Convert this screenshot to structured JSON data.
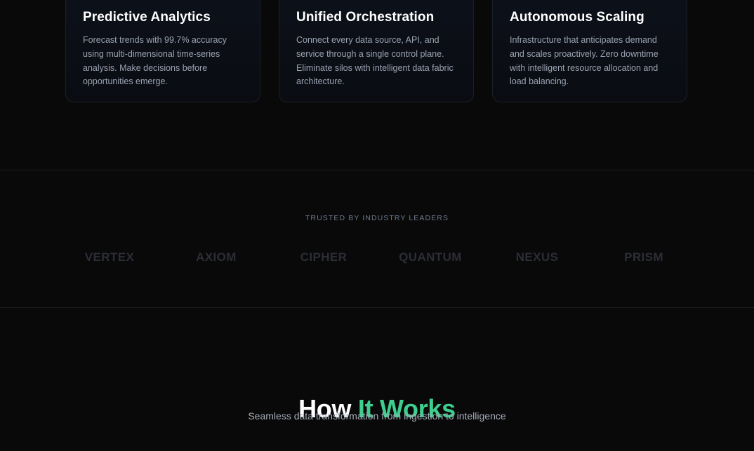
{
  "features": {
    "cards": [
      {
        "title": "Predictive Analytics",
        "description": "Forecast trends with 99.7% accuracy using multi-dimensional time-series analysis. Make decisions before opportunities emerge."
      },
      {
        "title": "Unified Orchestration",
        "description": "Connect every data source, API, and service through a single control plane. Eliminate silos with intelligent data fabric architecture."
      },
      {
        "title": "Autonomous Scaling",
        "description": "Infrastructure that anticipates demand and scales proactively. Zero downtime with intelligent resource allocation and load balancing."
      }
    ]
  },
  "trusted": {
    "label": "TRUSTED BY INDUSTRY LEADERS",
    "logos": [
      "VERTEX",
      "AXIOM",
      "CIPHER",
      "QUANTUM",
      "NEXUS",
      "PRISM"
    ]
  },
  "how": {
    "title_part1": "How ",
    "title_accent": "It Works",
    "subtitle": "Seamless data transformation from ingestion to intelligence"
  },
  "colors": {
    "background": "#09090a",
    "accent": "#3ecf8e",
    "card_border": "#1b1f28",
    "muted_text": "#9aa3b2",
    "logo_text": "#2b2e35"
  }
}
